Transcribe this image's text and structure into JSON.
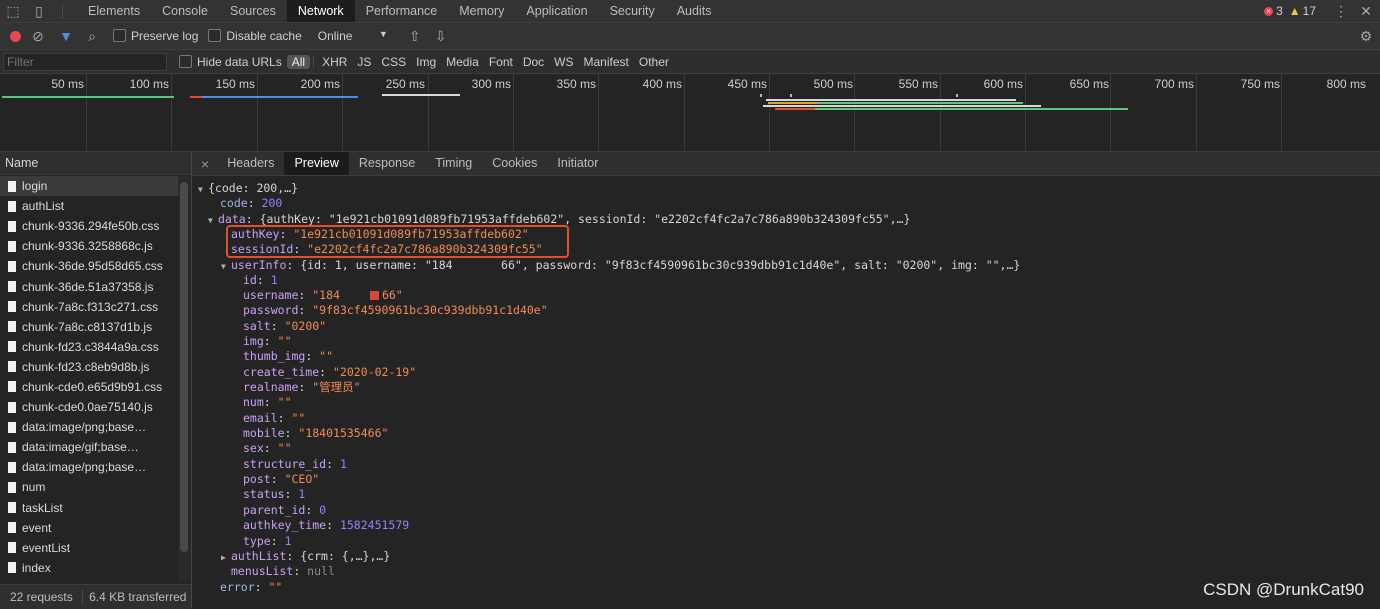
{
  "devtools": {
    "tabs": [
      "Elements",
      "Console",
      "Sources",
      "Network",
      "Performance",
      "Memory",
      "Application",
      "Security",
      "Audits"
    ],
    "active_tab": "Network",
    "errors": "3",
    "warnings": "17"
  },
  "toolbar": {
    "preserve_log": "Preserve log",
    "disable_cache": "Disable cache",
    "throttle": "Online"
  },
  "filterbar": {
    "placeholder": "Filter",
    "hide_data_urls": "Hide data URLs",
    "types": [
      "All",
      "XHR",
      "JS",
      "CSS",
      "Img",
      "Media",
      "Font",
      "Doc",
      "WS",
      "Manifest",
      "Other"
    ],
    "selected_type": "All"
  },
  "timeline": {
    "ticks": [
      "50 ms",
      "100 ms",
      "150 ms",
      "200 ms",
      "250 ms",
      "300 ms",
      "350 ms",
      "400 ms",
      "450 ms",
      "500 ms",
      "550 ms",
      "600 ms",
      "650 ms",
      "700 ms",
      "750 ms",
      "800 ms"
    ]
  },
  "request_list": {
    "header": "Name",
    "items": [
      "login",
      "authList",
      "chunk-9336.294fe50b.css",
      "chunk-9336.3258868c.js",
      "chunk-36de.95d58d65.css",
      "chunk-36de.51a37358.js",
      "chunk-7a8c.f313c271.css",
      "chunk-7a8c.c8137d1b.js",
      "chunk-fd23.c3844a9a.css",
      "chunk-fd23.c8eb9d8b.js",
      "chunk-cde0.e65d9b91.css",
      "chunk-cde0.0ae75140.js",
      "data:image/png;base…",
      "data:image/gif;base…",
      "data:image/png;base…",
      "num",
      "taskList",
      "event",
      "eventList",
      "index"
    ],
    "selected": "login",
    "status_requests": "22 requests",
    "status_transferred": "6.4 KB transferred"
  },
  "detail": {
    "close": "×",
    "tabs": [
      "Headers",
      "Preview",
      "Response",
      "Timing",
      "Cookies",
      "Initiator"
    ],
    "active_tab": "Preview"
  },
  "preview": {
    "root_summary": "{code: 200,…}",
    "code": "200",
    "data_summary": "{authKey: \"1e921cb01091d089fb71953affdeb602\", sessionId: \"e2202cf4fc2a7c786a890b324309fc55\",…}",
    "authKey": "\"1e921cb01091d089fb71953affdeb602\"",
    "sessionId": "\"e2202cf4fc2a7c786a890b324309fc55\"",
    "userInfo_summary_a": "{id: 1, username: \"184",
    "userInfo_summary_b": "66\", password: \"9f83cf4590961bc30c939dbb91c1d40e\", salt: \"0200\", img: \"\",…}",
    "id": "1",
    "username_a": "\"184",
    "username_b": "66\"",
    "password": "\"9f83cf4590961bc30c939dbb91c1d40e\"",
    "salt": "\"0200\"",
    "img": "\"\"",
    "thumb_img": "\"\"",
    "create_time": "\"2020-02-19\"",
    "realname": "\"管理员\"",
    "num": "\"\"",
    "email": "\"\"",
    "mobile": "\"18401535466\"",
    "sex": "\"\"",
    "structure_id": "1",
    "post": "\"CEO\"",
    "status": "1",
    "parent_id": "0",
    "authkey_time": "1582451579",
    "type": "1",
    "authList_summary": "{crm: {,…},…}",
    "menusList": "null",
    "error": "\"\""
  },
  "watermark": "CSDN @DrunkCat90"
}
